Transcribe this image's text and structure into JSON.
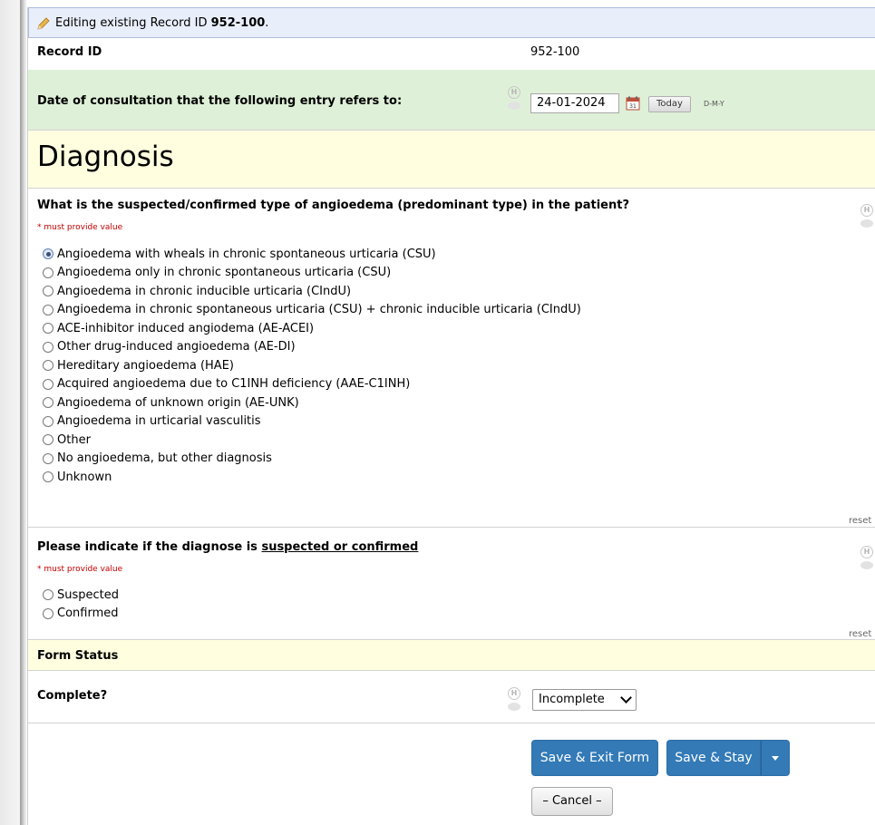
{
  "editing": {
    "prefix": "Editing existing Record ID ",
    "record_id": "952-100",
    "suffix": "."
  },
  "record": {
    "label": "Record ID",
    "value": "952-100"
  },
  "date_field": {
    "label": "Date of consultation that the following entry refers to:",
    "value": "24-01-2024",
    "today_label": "Today",
    "format_label": "D-M-Y"
  },
  "section": {
    "title": "Diagnosis"
  },
  "q1": {
    "label": "What is the suspected/confirmed type of angioedema (predominant type) in the patient?",
    "required": "* must provide value",
    "selected_index": 0,
    "options": [
      "Angioedema with wheals in chronic spontaneous urticaria (CSU)",
      "Angioedema only in chronic spontaneous urticaria (CSU)",
      "Angioedema in chronic inducible urticaria (CIndU)",
      "Angioedema in chronic spontaneous urticaria (CSU) + chronic inducible urticaria (CIndU)",
      "ACE-inhibitor induced angiodema (AE-ACEI)",
      "Other drug-induced angioedema (AE-DI)",
      "Hereditary angioedema (HAE)",
      "Acquired angioedema due to C1INH deficiency (AAE-C1INH)",
      "Angioedema of unknown origin (AE-UNK)",
      "Angioedema in urticarial vasculitis",
      "Other",
      "No angioedema, but other diagnosis",
      "Unknown"
    ],
    "reset": "reset"
  },
  "q2": {
    "label_prefix": "Please indicate if the diagnose is ",
    "label_underlined": "suspected or confirmed",
    "required": "* must provide value",
    "options": [
      "Suspected",
      "Confirmed"
    ],
    "reset": "reset"
  },
  "form_status": {
    "header": "Form Status",
    "complete_label": "Complete?",
    "complete_value": "Incomplete"
  },
  "buttons": {
    "save_exit": "Save & Exit Form",
    "save_stay": "Save & Stay",
    "cancel": "– Cancel –"
  },
  "colors": {
    "primary": "#337ab7",
    "date_row_bg": "#dff0d8",
    "section_bg": "#ffffe0",
    "editing_bg": "#e8eefa",
    "required": "#c00000"
  }
}
